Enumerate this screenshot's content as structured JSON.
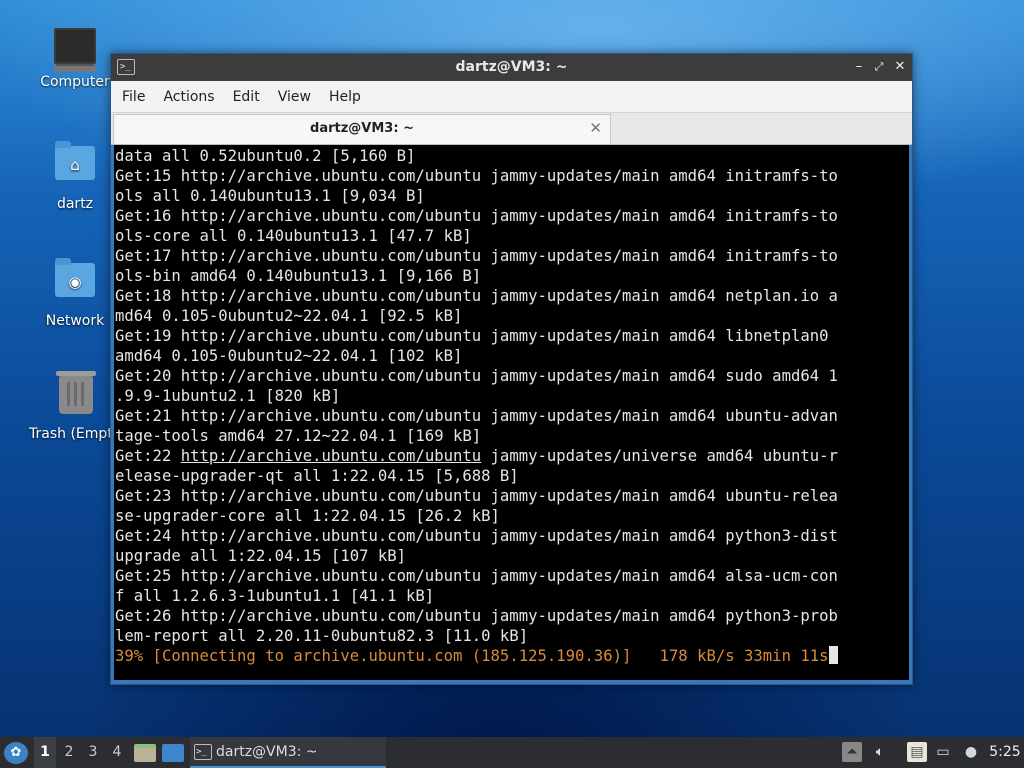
{
  "desktop": {
    "icons": [
      {
        "label": "Computer"
      },
      {
        "label": "dartz"
      },
      {
        "label": "Network"
      },
      {
        "label": "Trash (Empty)"
      }
    ]
  },
  "window": {
    "title": "dartz@VM3: ~",
    "menu": [
      "File",
      "Actions",
      "Edit",
      "View",
      "Help"
    ],
    "tab_label": "dartz@VM3: ~",
    "icons": {
      "app": "terminal-icon",
      "minimize": "minimize-icon",
      "maximize": "maximize-icon",
      "close": "close-icon",
      "tab_close": "close-icon"
    }
  },
  "terminal": {
    "lines": [
      "data all 0.52ubuntu0.2 [5,160 B]",
      "Get:15 http://archive.ubuntu.com/ubuntu jammy-updates/main amd64 initramfs-to",
      "ols all 0.140ubuntu13.1 [9,034 B]",
      "Get:16 http://archive.ubuntu.com/ubuntu jammy-updates/main amd64 initramfs-to",
      "ols-core all 0.140ubuntu13.1 [47.7 kB]",
      "Get:17 http://archive.ubuntu.com/ubuntu jammy-updates/main amd64 initramfs-to",
      "ols-bin amd64 0.140ubuntu13.1 [9,166 B]",
      "Get:18 http://archive.ubuntu.com/ubuntu jammy-updates/main amd64 netplan.io a",
      "md64 0.105-0ubuntu2~22.04.1 [92.5 kB]",
      "Get:19 http://archive.ubuntu.com/ubuntu jammy-updates/main amd64 libnetplan0",
      "amd64 0.105-0ubuntu2~22.04.1 [102 kB]",
      "Get:20 http://archive.ubuntu.com/ubuntu jammy-updates/main amd64 sudo amd64 1",
      ".9.9-1ubuntu2.1 [820 kB]",
      "Get:21 http://archive.ubuntu.com/ubuntu jammy-updates/main amd64 ubuntu-advan",
      "tage-tools amd64 27.12~22.04.1 [169 kB]"
    ],
    "line22": {
      "prefix": "Get:22 ",
      "link": "http://archive.ubuntu.com/ubuntu",
      "suffix": " jammy-updates/universe amd64 ubuntu-r"
    },
    "lines_after": [
      "elease-upgrader-qt all 1:22.04.15 [5,688 B]",
      "Get:23 http://archive.ubuntu.com/ubuntu jammy-updates/main amd64 ubuntu-relea",
      "se-upgrader-core all 1:22.04.15 [26.2 kB]",
      "Get:24 http://archive.ubuntu.com/ubuntu jammy-updates/main amd64 python3-dist",
      "upgrade all 1:22.04.15 [107 kB]",
      "Get:25 http://archive.ubuntu.com/ubuntu jammy-updates/main amd64 alsa-ucm-con",
      "f all 1.2.6.3-1ubuntu1.1 [41.1 kB]",
      "Get:26 http://archive.ubuntu.com/ubuntu jammy-updates/main amd64 python3-prob",
      "lem-report all 2.20.11-0ubuntu82.3 [11.0 kB]"
    ],
    "progress_line": "39% [Connecting to archive.ubuntu.com (185.125.190.36)]   178 kB/s 33min 11s",
    "progress_color": "#d98a3a"
  },
  "taskbar": {
    "workspaces": [
      "1",
      "2",
      "3",
      "4"
    ],
    "active_workspace": "1",
    "task_label": "dartz@VM3: ~",
    "clock": "5:25",
    "icons": [
      "start-menu-icon",
      "file-manager-icon",
      "show-desktop-icon",
      "upload-icon",
      "volume-icon",
      "clipboard-icon",
      "network-icon",
      "notification-icon"
    ]
  }
}
